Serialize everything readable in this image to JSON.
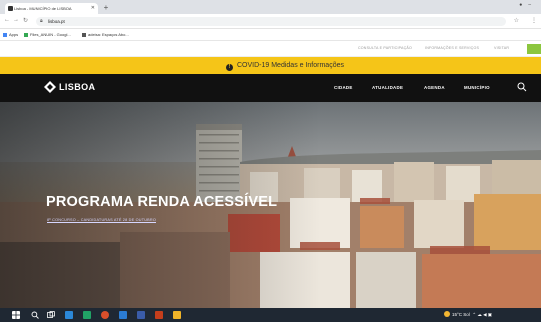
{
  "browser": {
    "tab_title": "Lisboa - MUNICÍPIO de LISBOA",
    "url": "lisboa.pt",
    "bookmarks": [
      "Apps",
      "Files_ANUIN - Googl...",
      "adeisa: Espaços Abo..."
    ]
  },
  "site": {
    "utility_links": [
      "CONSULTA E PARTICIPAÇÃO",
      "INFORMAÇÕES E SERVIÇOS",
      "VISITAR"
    ],
    "covid_banner": "COVID-19 Medidas e Informações",
    "logo": "LISBOA",
    "nav": [
      "CIDADE",
      "ATUALIDADE",
      "AGENDA",
      "MUNICÍPIO"
    ],
    "hero": {
      "title": "PROGRAMA RENDA ACESSÍVEL",
      "link": "8º CONCURSO – CANDIDATURAS ATÉ 28 DE OUTUBRO"
    }
  },
  "taskbar": {
    "weather": "15°C Sol"
  },
  "colors": {
    "banner": "#f5c518",
    "header": "#111111",
    "taskbar": "#1f2833"
  }
}
